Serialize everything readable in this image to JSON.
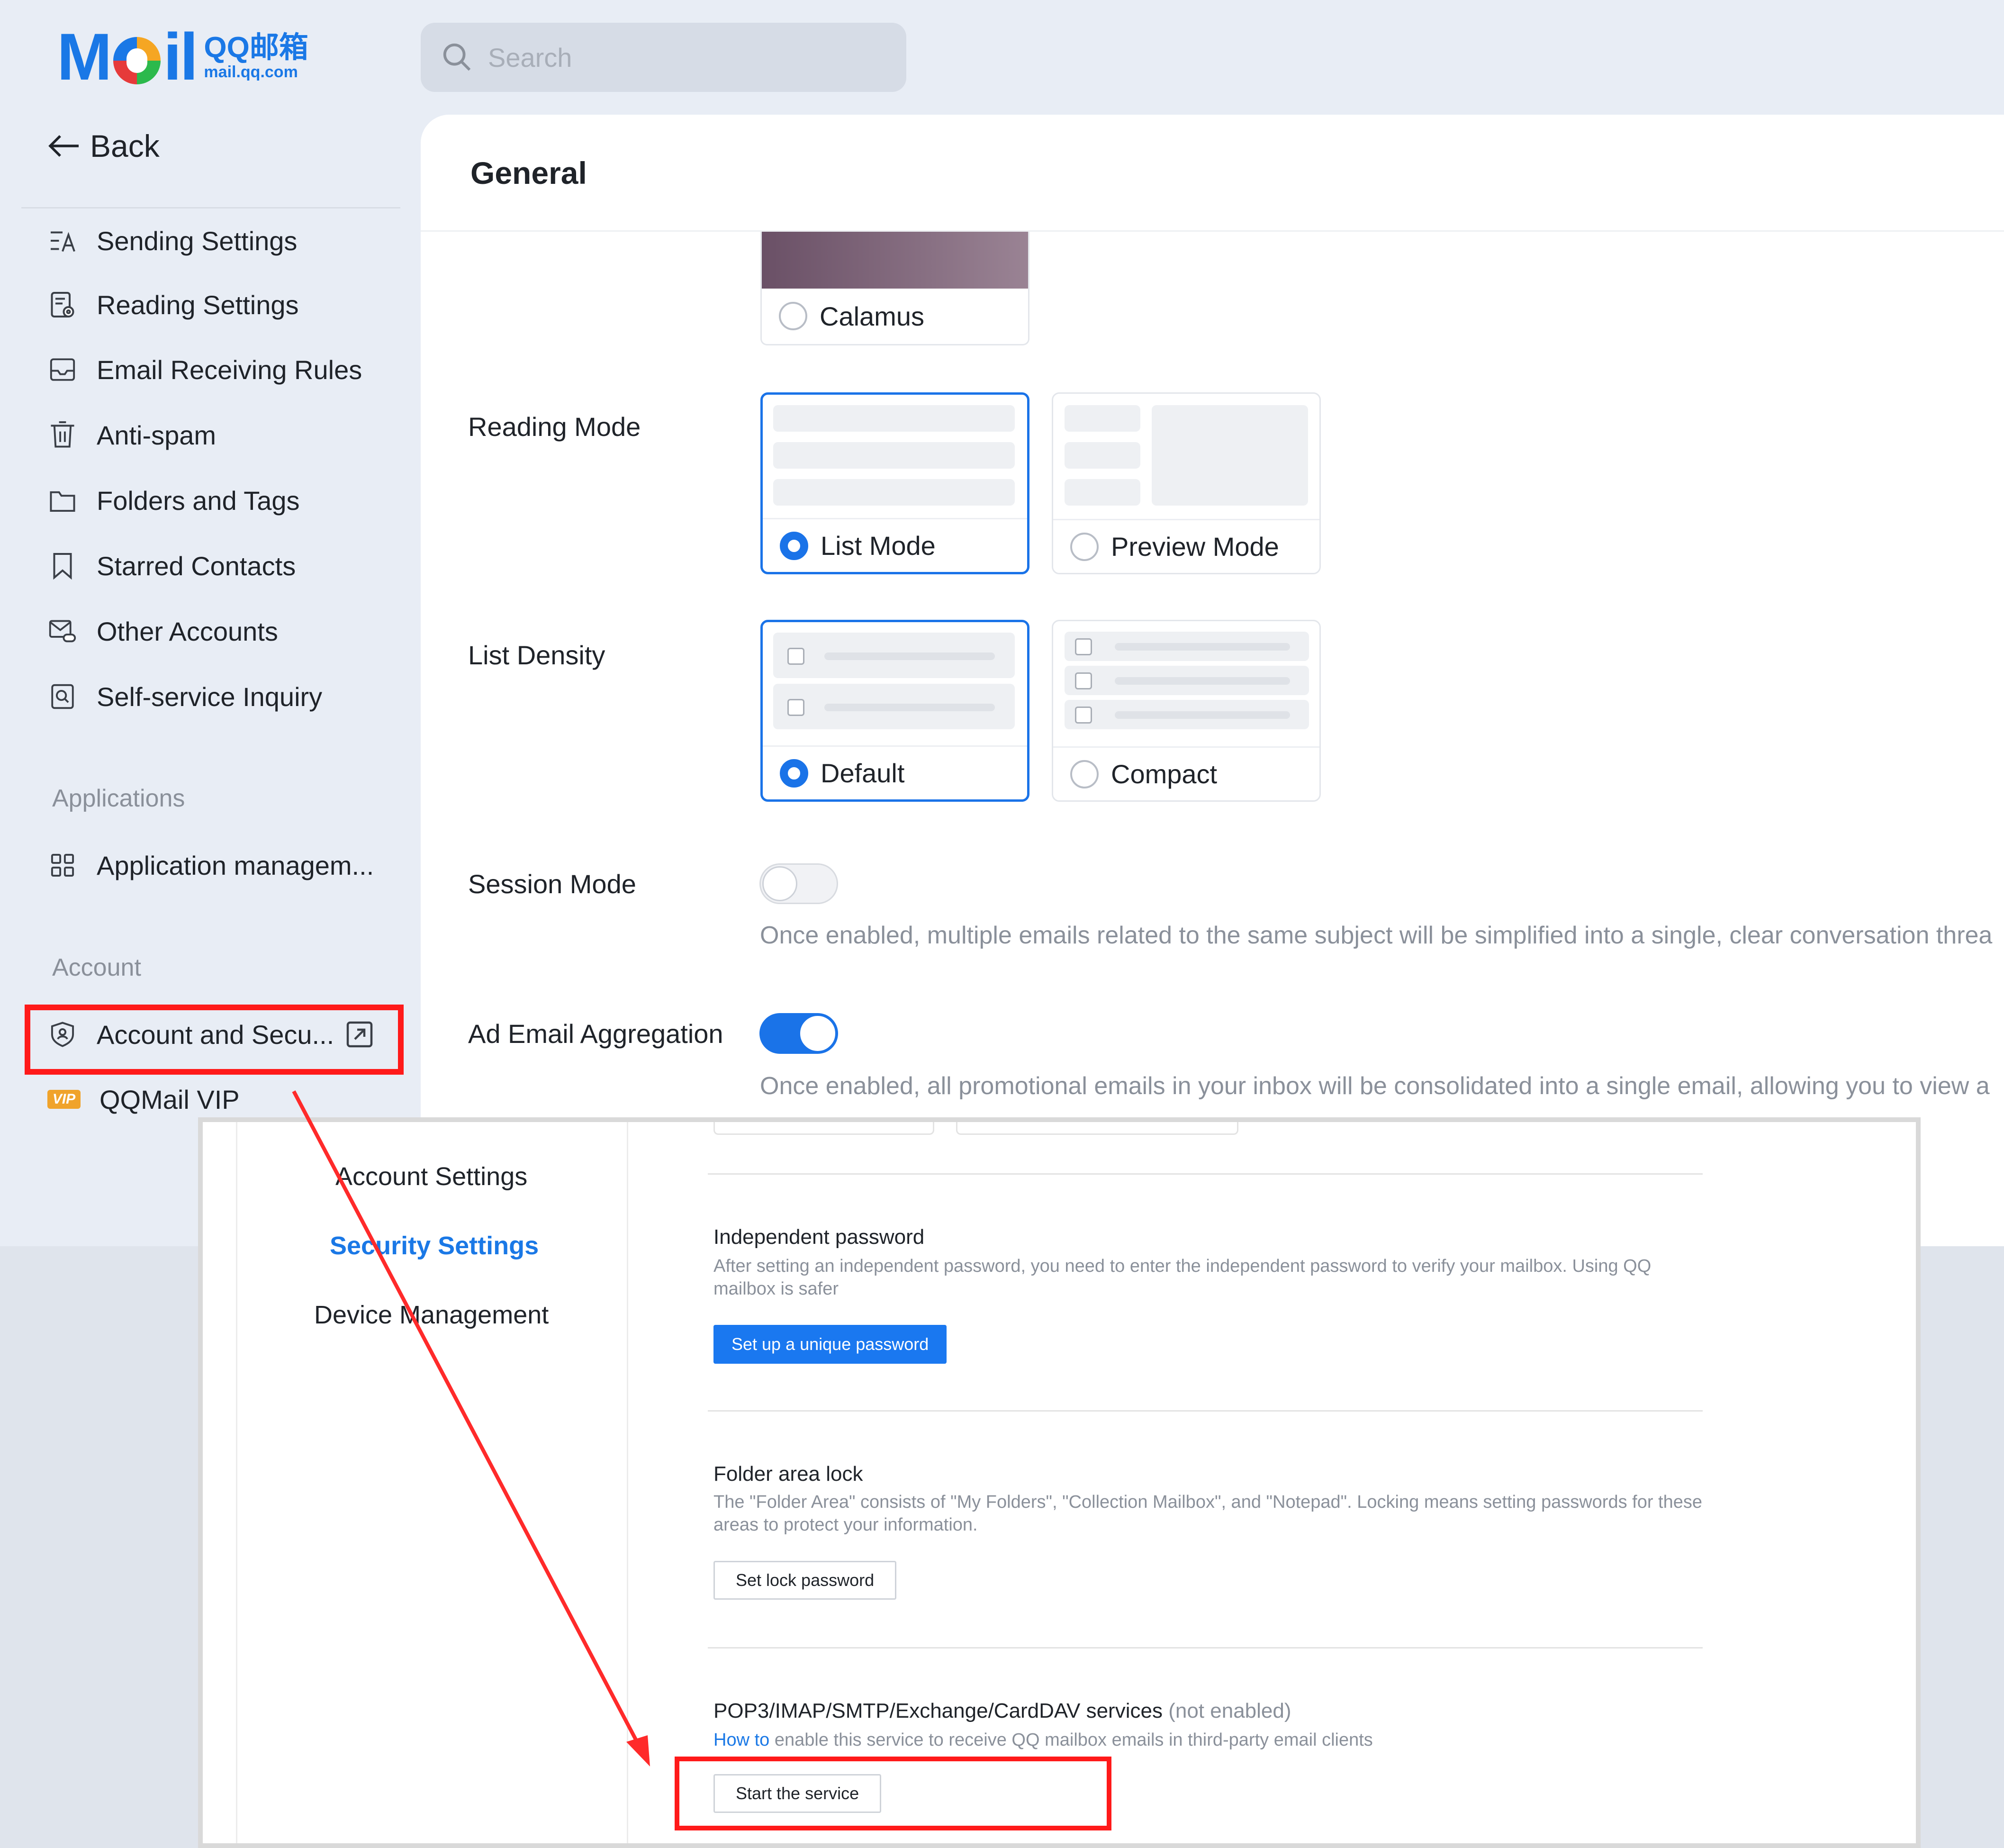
{
  "header": {
    "logo_text": "M",
    "logo_rest": "il",
    "logo_cn": "QQ邮箱",
    "logo_url": "mail.qq.com",
    "search_placeholder": "Search"
  },
  "sidebar": {
    "back_label": "Back",
    "items": [
      {
        "label": "Sending Settings",
        "icon": "send-settings-icon"
      },
      {
        "label": "Reading Settings",
        "icon": "reading-icon"
      },
      {
        "label": "Email Receiving Rules",
        "icon": "inbox-icon"
      },
      {
        "label": "Anti-spam",
        "icon": "trash-icon"
      },
      {
        "label": "Folders and Tags",
        "icon": "folder-icon"
      },
      {
        "label": "Starred Contacts",
        "icon": "bookmark-icon"
      },
      {
        "label": "Other Accounts",
        "icon": "mail-link-icon"
      },
      {
        "label": "Self-service Inquiry",
        "icon": "search-doc-icon"
      }
    ],
    "section_applications": "Applications",
    "app_item": "Application managem...",
    "section_account": "Account",
    "account_item": "Account and Secu...",
    "vip_badge": "VIP",
    "vip_item": "QQMail VIP"
  },
  "main": {
    "title": "General",
    "theme_name": "Calamus",
    "reading_mode": {
      "label": "Reading Mode",
      "options": [
        "List Mode",
        "Preview Mode"
      ],
      "selected": "List Mode"
    },
    "list_density": {
      "label": "List Density",
      "options": [
        "Default",
        "Compact"
      ],
      "selected": "Default"
    },
    "session_mode": {
      "label": "Session Mode",
      "enabled": false,
      "description": "Once enabled, multiple emails related to the same subject will be simplified into a single, clear conversation threa"
    },
    "ad_aggregation": {
      "label": "Ad Email Aggregation",
      "enabled": true,
      "description": "Once enabled, all promotional emails in your inbox will be consolidated into a single email, allowing you to view a"
    }
  },
  "overlay": {
    "tabs": [
      "Account Settings",
      "Security Settings",
      "Device Management"
    ],
    "active_tab": "Security Settings",
    "independent_password": {
      "title": "Independent password",
      "desc": "After setting an independent password, you need to enter the independent password to verify your mailbox. Using QQ mailbox is safer",
      "button": "Set up a unique password"
    },
    "folder_lock": {
      "title": "Folder area lock",
      "desc": "The \"Folder Area\" consists of \"My Folders\", \"Collection Mailbox\", and \"Notepad\". Locking means setting passwords for these areas to protect your information.",
      "button": "Set lock password"
    },
    "services": {
      "title": "POP3/IMAP/SMTP/Exchange/CardDAV services",
      "status": "(not enabled)",
      "link": "How to",
      "desc": "enable this service to receive QQ mailbox emails in third-party email clients",
      "button": "Start the service"
    }
  },
  "colors": {
    "accent": "#1a73e8",
    "highlight": "#ff1a1a"
  }
}
